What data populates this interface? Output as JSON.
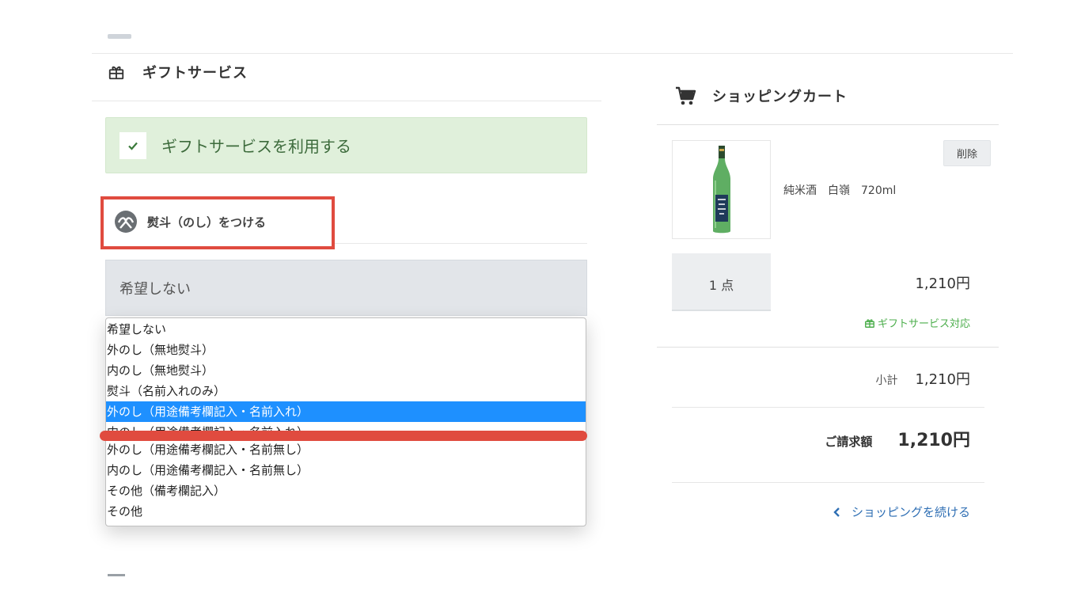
{
  "gift": {
    "heading": "ギフトサービス",
    "use_label": "ギフトサービスを利用する",
    "use_checked": true
  },
  "noshi": {
    "heading": "熨斗（のし）をつける",
    "selected_value": "希望しない",
    "options": [
      "希望しない",
      "外のし（無地熨斗）",
      "内のし（無地熨斗）",
      "熨斗（名前入れのみ）",
      "外のし（用途備考欄記入・名前入れ）",
      "内のし（用途備考欄記入・名前入れ）",
      "外のし（用途備考欄記入・名前無し）",
      "内のし（用途備考欄記入・名前無し）",
      "その他（備考欄記入）",
      "その他"
    ],
    "highlighted_index": 4
  },
  "cart": {
    "heading": "ショッピングカート",
    "item": {
      "name": "純米酒　白嶺　720ml",
      "delete_label": "削除",
      "quantity": "1 点",
      "price": "1,210円",
      "gift_eligible": "ギフトサービス対応"
    },
    "subtotal_label": "小計",
    "subtotal_value": "1,210円",
    "total_label": "ご請求額",
    "total_value": "1,210円",
    "continue_label": "ショッピングを続ける"
  },
  "colors": {
    "annotation_red": "#e04b3f",
    "option_highlight": "#1e90ff",
    "gift_green": "#4cae4c",
    "link_blue": "#2f6fb4"
  }
}
